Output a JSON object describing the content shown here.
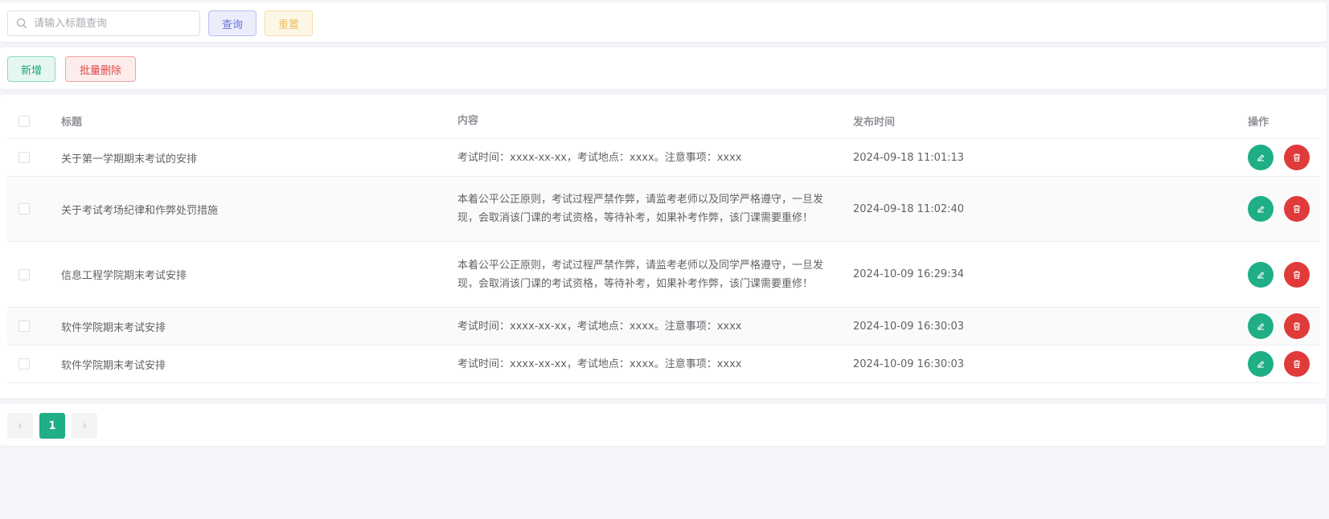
{
  "search": {
    "placeholder": "请输入标题查询",
    "query_label": "查询",
    "reset_label": "重置"
  },
  "actions": {
    "add_label": "新增",
    "batch_delete_label": "批量删除"
  },
  "table": {
    "columns": [
      "标题",
      "内容",
      "发布时间",
      "操作"
    ],
    "rows": [
      {
        "title": "关于第一学期期末考试的安排",
        "content": "考试时间：xxxx-xx-xx，考试地点：xxxx。注意事项：xxxx",
        "time": "2024-09-18 11:01:13"
      },
      {
        "title": "关于考试考场纪律和作弊处罚措施",
        "content": "本着公平公正原则，考试过程严禁作弊，请监考老师以及同学严格遵守，一旦发现，会取消该门课的考试资格，等待补考，如果补考作弊，该门课需要重修！",
        "time": "2024-09-18 11:02:40"
      },
      {
        "title": "信息工程学院期末考试安排",
        "content": "本着公平公正原则，考试过程严禁作弊，请监考老师以及同学严格遵守，一旦发现，会取消该门课的考试资格，等待补考，如果补考作弊，该门课需要重修！",
        "time": "2024-10-09 16:29:34"
      },
      {
        "title": "软件学院期末考试安排",
        "content": "考试时间：xxxx-xx-xx，考试地点：xxxx。注意事项：xxxx",
        "time": "2024-10-09 16:30:03"
      },
      {
        "title": "软件学院期末考试安排",
        "content": "考试时间：xxxx-xx-xx，考试地点：xxxx。注意事项：xxxx",
        "time": "2024-10-09 16:30:03"
      }
    ]
  },
  "pagination": {
    "current_page": "1"
  },
  "colors": {
    "primary": "#1fae85",
    "danger": "#e03a3a",
    "query": "#6a71d8",
    "reset": "#f0c061"
  }
}
